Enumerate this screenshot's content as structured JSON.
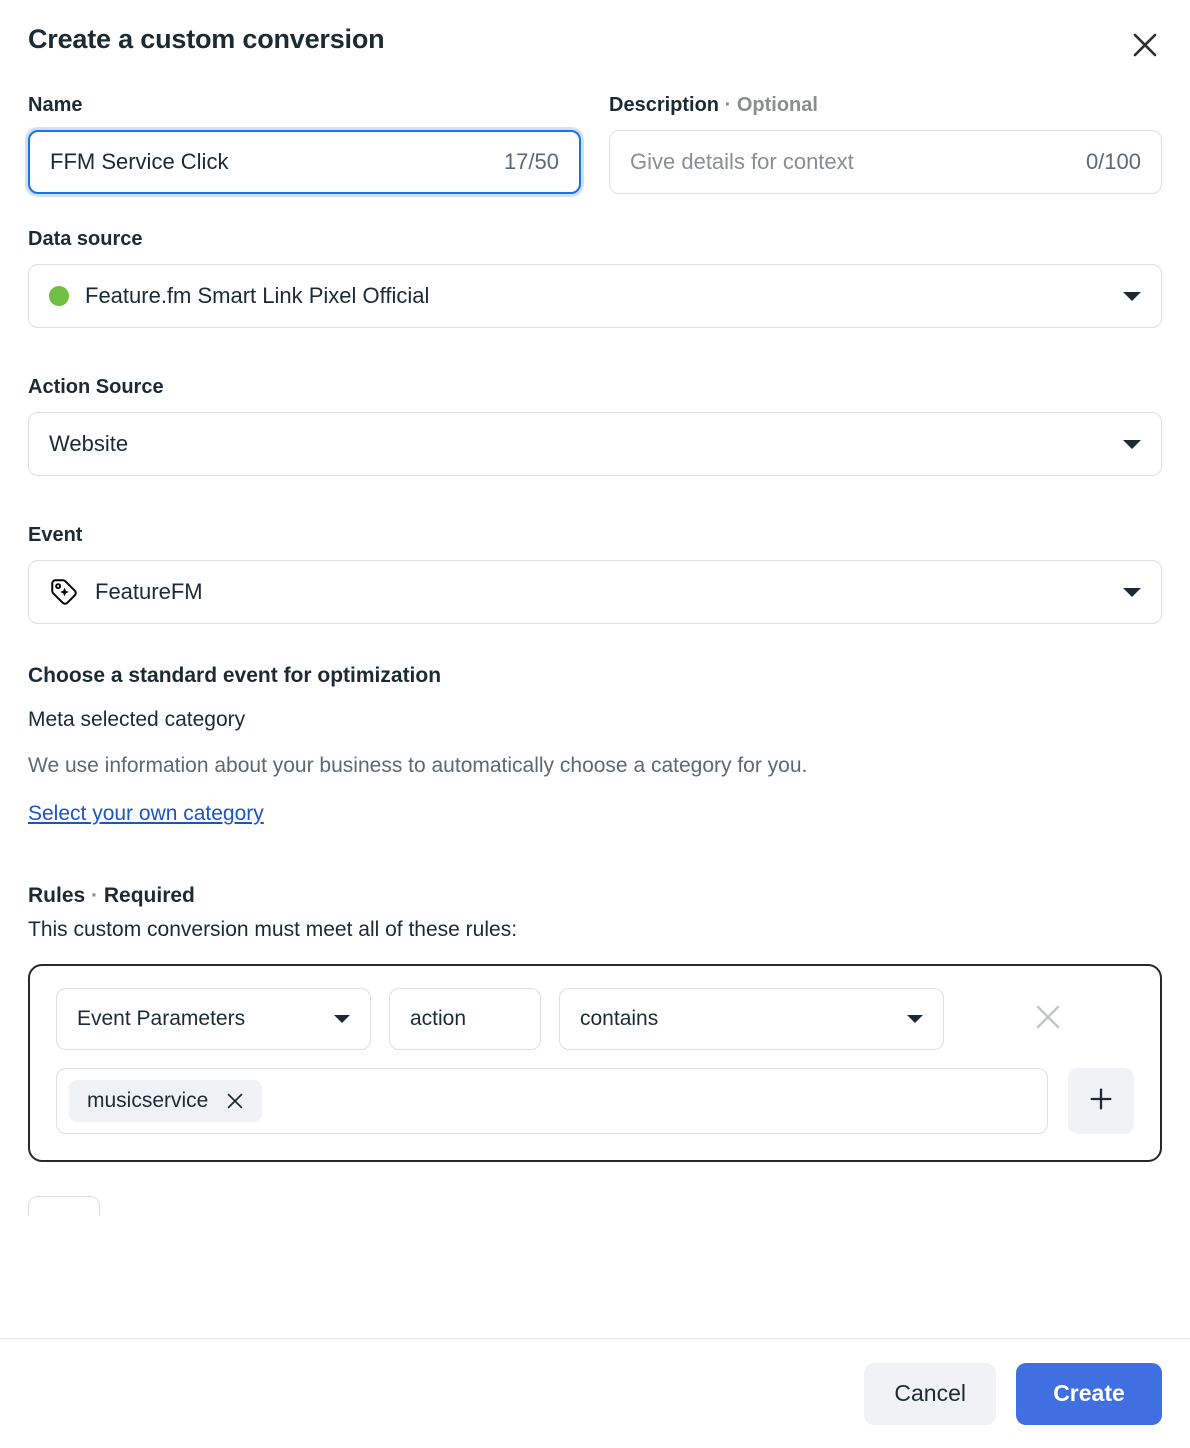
{
  "dialog": {
    "title": "Create a custom conversion",
    "close_icon": "close-icon"
  },
  "name_field": {
    "label": "Name",
    "value": "FFM Service Click",
    "counter": "17/50"
  },
  "description_field": {
    "label": "Description",
    "label_optional": "Optional",
    "separator": "·",
    "placeholder": "Give details for context",
    "counter": "0/100"
  },
  "data_source": {
    "label": "Data source",
    "value": "Feature.fm Smart Link Pixel Official",
    "status_color": "#6fbf42"
  },
  "action_source": {
    "label": "Action Source",
    "value": "Website"
  },
  "event": {
    "label": "Event",
    "value": "FeatureFM",
    "icon": "tag-icon"
  },
  "standard_event": {
    "heading": "Choose a standard event for optimization",
    "category_label": "Meta selected category",
    "description": "We use information about your business to automatically choose a category for you.",
    "link": "Select your own category"
  },
  "rules": {
    "heading": "Rules",
    "heading_suffix": "Required",
    "separator": "·",
    "subtitle": "This custom conversion must meet all of these rules:",
    "row": {
      "parameter": "Event Parameters",
      "key": "action",
      "operator": "contains",
      "tokens": [
        {
          "label": "musicservice"
        }
      ]
    }
  },
  "footer": {
    "cancel_label": "Cancel",
    "create_label": "Create",
    "primary_color": "#3f6fe0"
  }
}
